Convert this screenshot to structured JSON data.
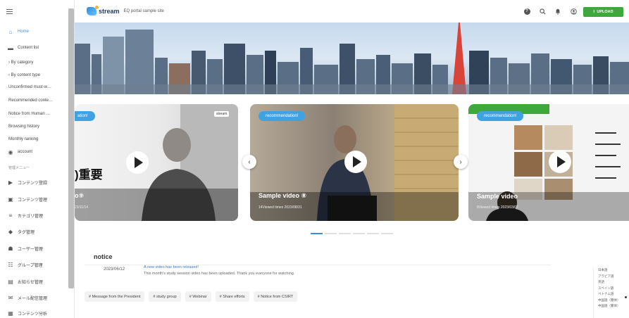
{
  "header": {
    "logo_text": "stream",
    "site_name": "EQ portal sample site",
    "upload_label": "UPLOAD",
    "colors": {
      "upload": "#3fa83c",
      "accent": "#4a8fd6"
    }
  },
  "sidebar": {
    "home": "Home",
    "content_list": "Content list",
    "by_category": "By category",
    "by_content_type": "By content type",
    "unconfirmed": "Unconfirmed must-w…",
    "recommended": "Recommended conte…",
    "notice_from_human": "Notice from Human …",
    "browsing_history": "Browsing history",
    "monthly_ranking": "Monthly ranking",
    "account": "account",
    "admin_section": "管理メニュー",
    "admin_items": [
      "コンテンツ登録",
      "コンテンツ管理",
      "カテゴリ管理",
      "タグ管理",
      "ユーザー管理",
      "グループ管理",
      "お知らせ管理",
      "メール配信管理",
      "コンテンツ分析"
    ]
  },
  "carousel": {
    "cards": [
      {
        "badge": "ation!",
        "title": "o⑨",
        "meta": "23/11/14",
        "overlay_text": ")重要",
        "logo": "stream"
      },
      {
        "badge": "recommendation!",
        "title": "Sample video ⑧",
        "meta": "14Viewed times 2023/08/31"
      },
      {
        "badge": "recommendation!",
        "title": "Sample video",
        "meta": "8Viewed times 2023/03/07"
      }
    ],
    "prev": "‹",
    "next": "›"
  },
  "notice": {
    "title": "notice",
    "date": "2023/06/12",
    "headline": "A new video has been released!",
    "body": "This month's study session video has been uploaded. Thank you everyone for watching."
  },
  "tags": [
    "# Message from the President",
    "# study group",
    "# Webinar",
    "# Share efforts",
    "# Notice from CSIRT"
  ],
  "languages": [
    "日本語",
    "アラビア語",
    "英語",
    "スペイン語",
    "ベトナム語",
    "中国語（簡体）",
    "中国語（繁体）"
  ]
}
